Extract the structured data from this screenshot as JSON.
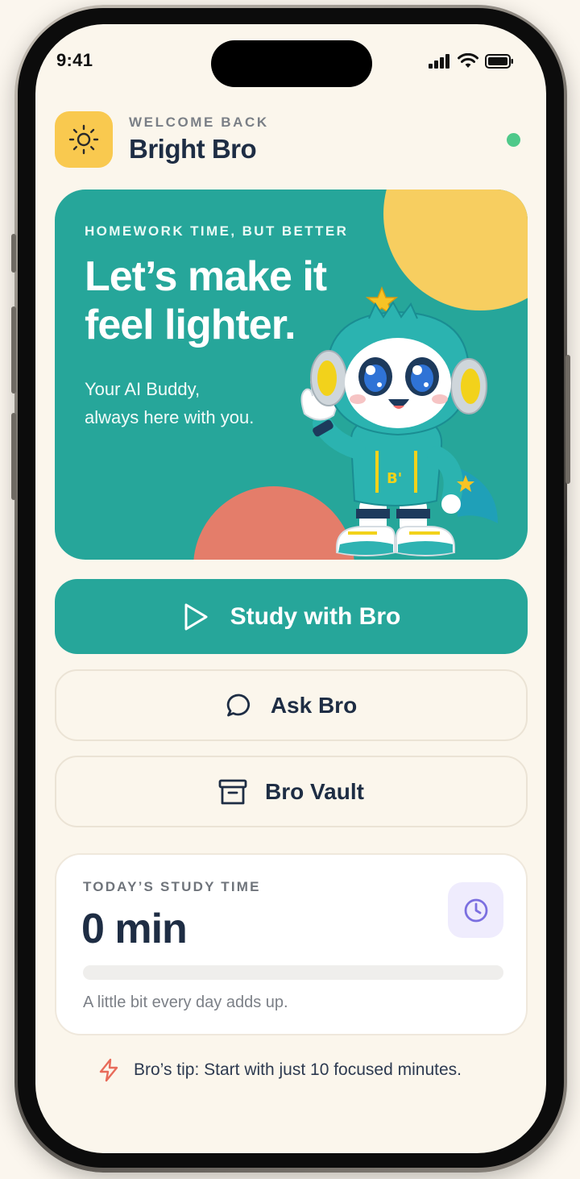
{
  "status_bar": {
    "time": "9:41"
  },
  "header": {
    "eyebrow": "WELCOME BACK",
    "name": "Bright Bro",
    "app_icon": "sun-icon",
    "status": "online"
  },
  "hero": {
    "eyebrow": "HOMEWORK TIME, BUT BETTER",
    "title": "Let’s make it feel lighter.",
    "subtitle_line1": "Your AI Buddy,",
    "subtitle_line2": "always here with you."
  },
  "actions": {
    "study_label": "Study with Bro",
    "ask_label": "Ask Bro",
    "vault_label": "Bro Vault"
  },
  "study": {
    "label": "TODAY’S STUDY TIME",
    "value": "0 min",
    "progress": 0,
    "note": "A little bit every day adds up."
  },
  "tip": {
    "text": "Bro’s tip: Start with just 10 focused minutes."
  },
  "colors": {
    "accent": "#26a69a",
    "yellow": "#f7ce60",
    "coral": "#e47d6a",
    "navy": "#1e2d44",
    "background": "#fbf6ec"
  }
}
